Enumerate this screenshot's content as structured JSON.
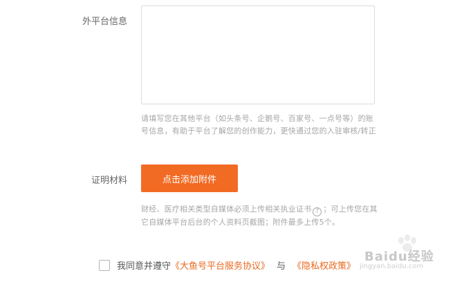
{
  "form": {
    "external_platform_label": "外平台信息",
    "external_platform_hint": "请填写您在其他平台（如头条号、企鹅号、百家号、一点号等）的账号信息，有助于平台了解您的创作能力，更快通过您的入驻审核/转正",
    "proof_label": "证明材料",
    "upload_button_label": "点击添加附件",
    "proof_hint_before_icon": "财经、医疗相关类型自媒体必须上传相关执业证书",
    "help_icon_glyph": "?",
    "proof_hint_after_icon": "；可上传您在其它自媒体平台后台的个人资料页截图；附件最多上传5个。"
  },
  "agreement": {
    "prefix": "我同意并遵守",
    "service_link": "《大鱼号平台服务协议》",
    "and": "与",
    "privacy_link": "《隐私权政策》"
  },
  "watermark": {
    "brand": "Baidu经验",
    "url": "jingyan.baidu.com"
  },
  "colors": {
    "accent": "#f26b24",
    "link": "#e9691f"
  }
}
